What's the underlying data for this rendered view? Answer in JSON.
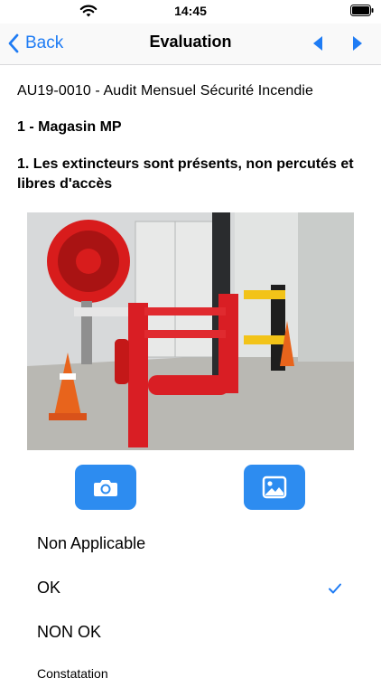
{
  "status_bar": {
    "time": "14:45"
  },
  "nav": {
    "back_label": "Back",
    "title": "Evaluation"
  },
  "audit": {
    "title": "AU19-0010 - Audit Mensuel Sécurité Incendie",
    "section": "1 - Magasin MP",
    "question": "1. Les extincteurs sont présents, non percutés et libres d'accès"
  },
  "photo": {
    "icon": "photo-of-fire-hose-reel-and-extinguisher"
  },
  "actions": {
    "camera_icon": "camera-icon",
    "gallery_icon": "image-gallery-icon"
  },
  "options": [
    {
      "label": "Non Applicable",
      "selected": false
    },
    {
      "label": "OK",
      "selected": true
    },
    {
      "label": "NON OK",
      "selected": false
    }
  ],
  "constatation_label": "Constatation",
  "colors": {
    "accent": "#1f7cf4",
    "button_bg": "#2d8cf0"
  }
}
